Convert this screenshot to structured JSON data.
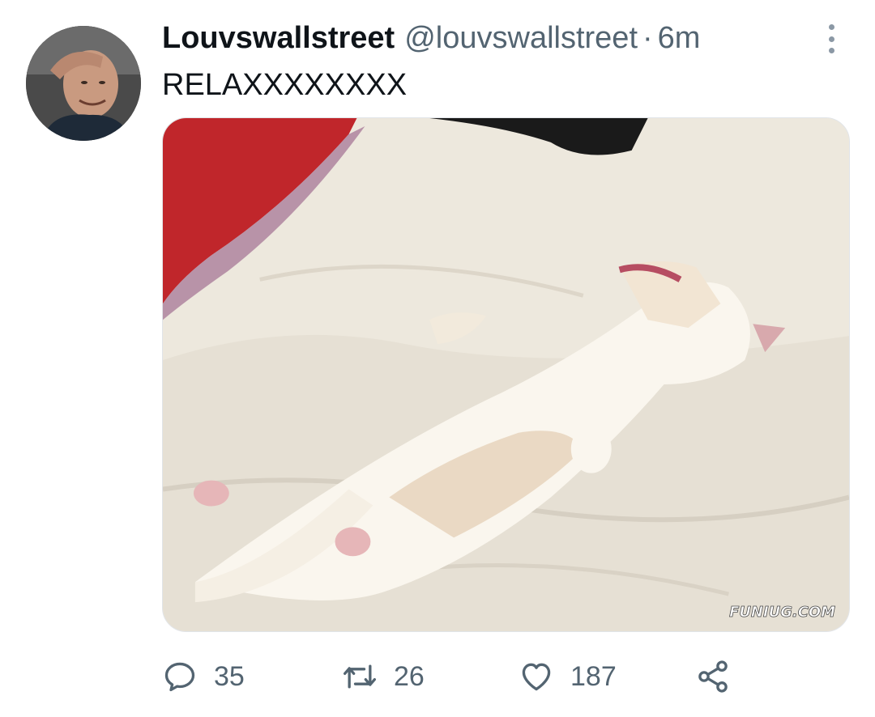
{
  "tweet": {
    "display_name": "Louvswallstreet",
    "handle": "@louvswallstreet",
    "separator": "·",
    "time": "6m",
    "text": "RELAXXXXXXXX",
    "media": {
      "watermark": "FUNIUG.COM"
    }
  },
  "actions": {
    "reply": {
      "icon": "reply-icon",
      "count": "35"
    },
    "retweet": {
      "icon": "retweet-icon",
      "count": "26"
    },
    "like": {
      "icon": "heart-icon",
      "count": "187"
    },
    "share": {
      "icon": "share-icon"
    }
  },
  "colors": {
    "text_primary": "#0f1419",
    "text_secondary": "#536471",
    "icon": "#536471"
  }
}
